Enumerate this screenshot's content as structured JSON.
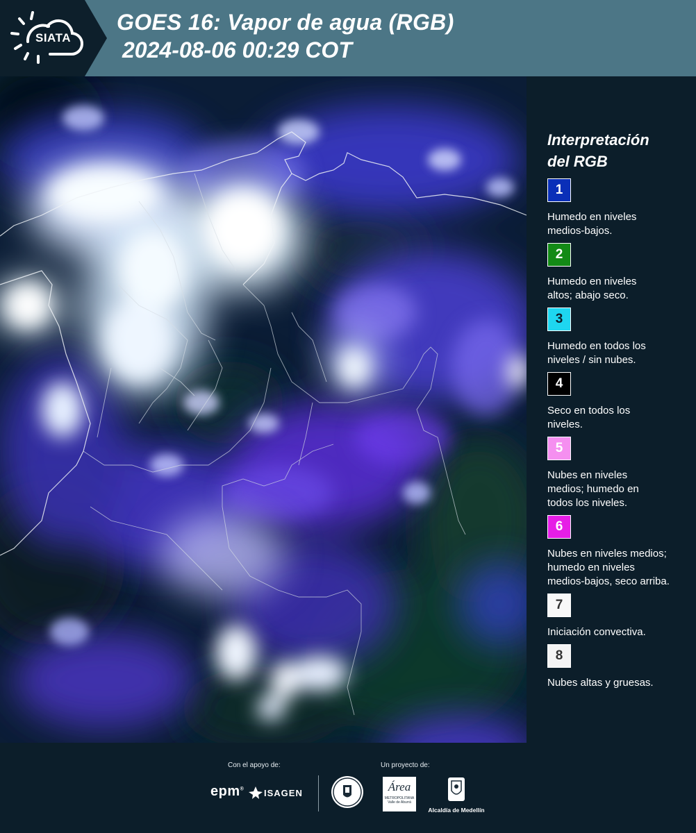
{
  "header": {
    "logo_text": "SIATA",
    "title_line1": "GOES 16: Vapor de agua (RGB)",
    "title_line2": " 2024-08-06 00:29 COT"
  },
  "legend": {
    "title_line1": "Interpretación",
    "title_line2": "del RGB",
    "items": [
      {
        "num": "1",
        "color": "#0a2fb8",
        "text_color": "#ffffff",
        "line1": "Humedo en niveles",
        "line2": "medios-bajos.",
        "line3": ""
      },
      {
        "num": "2",
        "color": "#138a16",
        "text_color": "#ffffff",
        "line1": "Humedo en niveles",
        "line2": "altos; abajo seco.",
        "line3": ""
      },
      {
        "num": "3",
        "color": "#1ed6f0",
        "text_color": "#0c1e2a",
        "line1": "Humedo en todos los",
        "line2": "niveles / sin nubes.",
        "line3": ""
      },
      {
        "num": "4",
        "color": "#000000",
        "text_color": "#ffffff",
        "line1": "Seco en todos los",
        "line2": "niveles.",
        "line3": ""
      },
      {
        "num": "5",
        "color": "#f58ff0",
        "text_color": "#ffffff",
        "line1": "Nubes en niveles",
        "line2": "medios; humedo en",
        "line3": "todos los niveles."
      },
      {
        "num": "6",
        "color": "#e61ee6",
        "text_color": "#ffffff",
        "line1": "Nubes en niveles medios;",
        "line2": "humedo en niveles",
        "line3": "medios-bajos, seco arriba."
      },
      {
        "num": "7",
        "color": "#f8f8f8",
        "text_color": "#333333",
        "line1": "Iniciación convectiva.",
        "line2": "",
        "line3": ""
      },
      {
        "num": "8",
        "color": "#f4f4f4",
        "text_color": "#333333",
        "line1": "Nubes altas y gruesas.",
        "line2": "",
        "line3": ""
      }
    ]
  },
  "footer": {
    "support_label": "Con el apoyo de:",
    "project_label": "Un proyecto de:",
    "epm": "epm",
    "isagen": "ISAGEN",
    "area_logo": "Área",
    "area_sub1": "METROPOLITANA",
    "area_sub2": "Valle de Aburrá",
    "alcaldia": "Alcaldía de Medellín"
  }
}
